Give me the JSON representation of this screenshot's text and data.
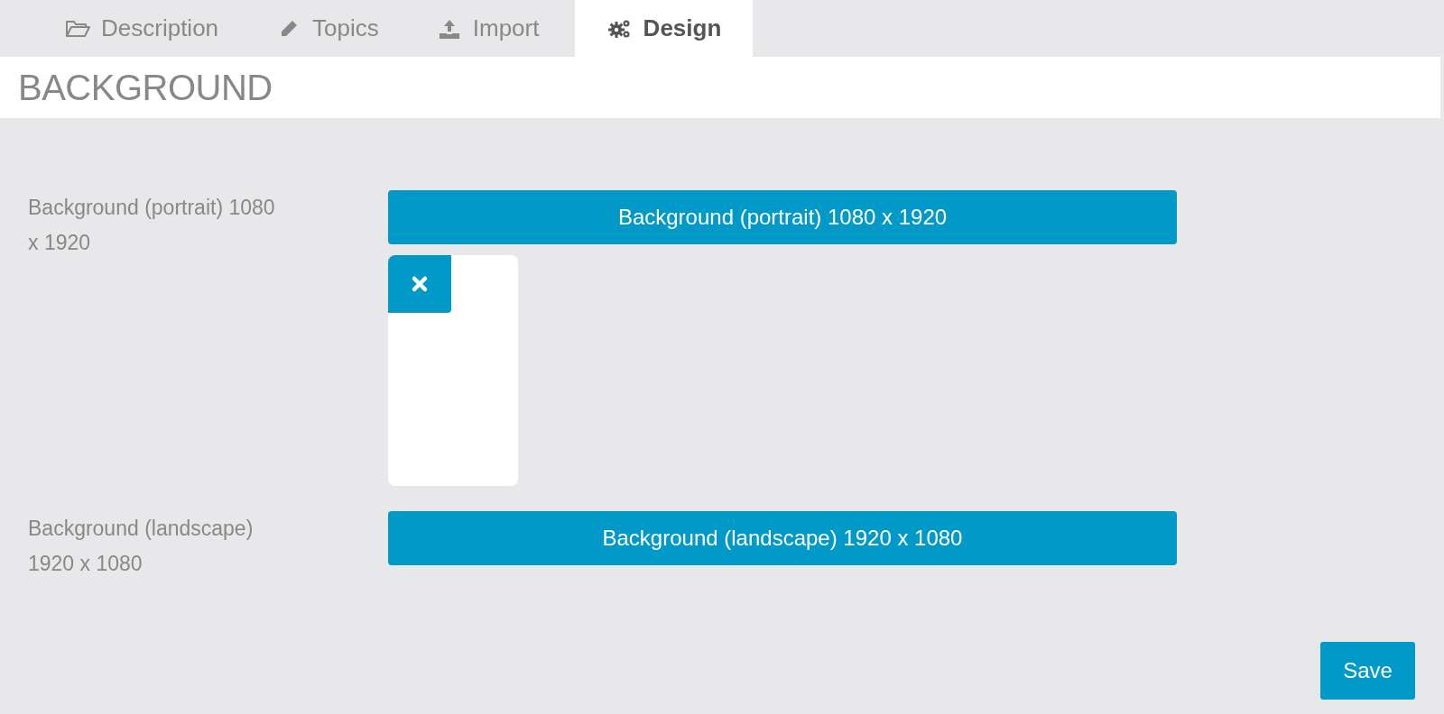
{
  "tabs": [
    {
      "label": "Description",
      "selected": false
    },
    {
      "label": "Topics",
      "selected": false
    },
    {
      "label": "Import",
      "selected": false
    },
    {
      "label": "Design",
      "selected": true
    }
  ],
  "section_title": "BACKGROUND",
  "fields": [
    {
      "label": "Background (portrait) 1080 x 1920",
      "button": "Background (portrait) 1080 x 1920",
      "preview": true
    },
    {
      "label": "Background (landscape) 1920 x 1080",
      "button": "Background (landscape) 1920 x 1080",
      "preview": false
    }
  ],
  "save_button": "Save"
}
